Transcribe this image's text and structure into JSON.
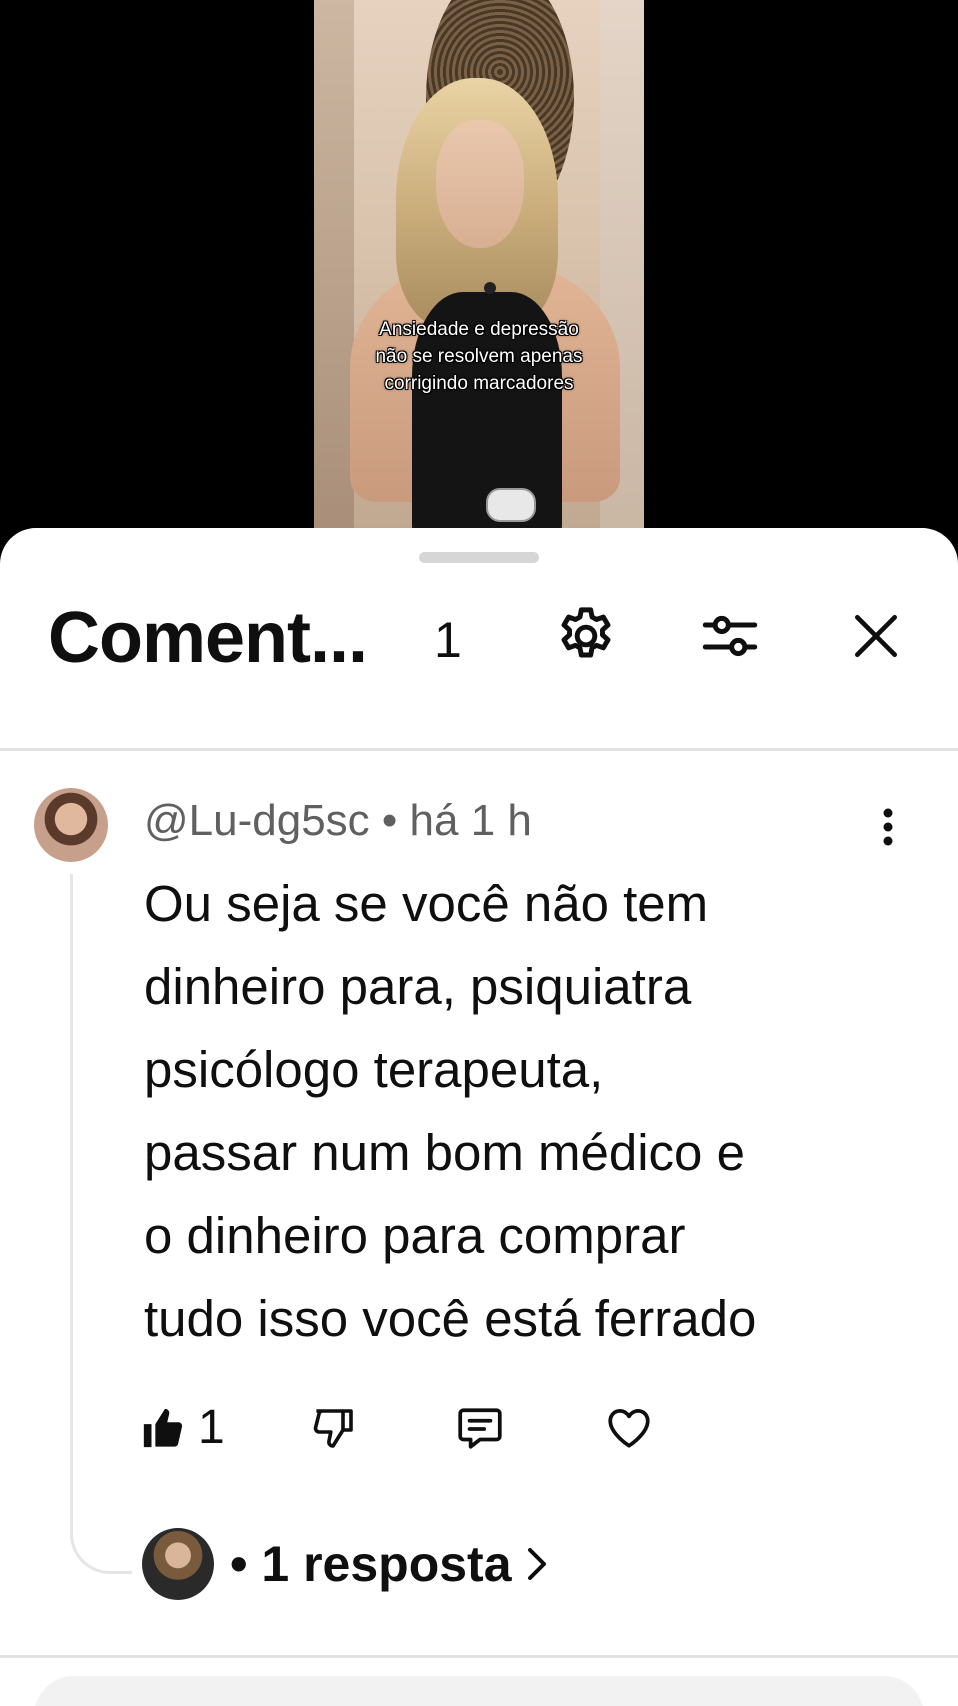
{
  "video": {
    "caption_lines": [
      "Ansiedade e depressão",
      "não se resolvem apenas",
      "corrigindo marcadores"
    ]
  },
  "comments_panel": {
    "title": "Coment...",
    "count": "1",
    "icons": {
      "settings": "gear-icon",
      "filter": "sliders-icon",
      "close": "close-icon"
    }
  },
  "comment": {
    "meta": "@Lu-dg5sc • há 1 h",
    "body_lines": [
      "Ou seja se você não tem",
      "dinheiro para, psiquiatra",
      "psicólogo terapeuta,",
      "passar num bom médico e",
      "o dinheiro para comprar",
      "tudo isso você está ferrado"
    ],
    "like_count": "1",
    "icons": {
      "like": "thumbs-up-icon",
      "dislike": "thumbs-down-icon",
      "reply": "comment-icon",
      "heart": "heart-icon",
      "more": "more-vertical-icon"
    },
    "replies_label": "• 1 resposta"
  },
  "colors": {
    "text_primary": "#0f0f0f",
    "text_secondary": "#606060",
    "divider": "#e2e2e2",
    "sheet_bg": "#ffffff"
  }
}
